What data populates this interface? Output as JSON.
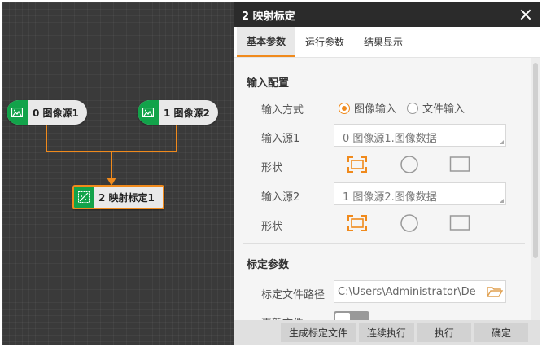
{
  "canvas": {
    "nodes": [
      {
        "label": "0 图像源1",
        "icon": "image-icon"
      },
      {
        "label": "1 图像源2",
        "icon": "image-icon"
      },
      {
        "label": "2 映射标定1",
        "icon": "calibration-icon",
        "selected": true
      }
    ],
    "connector_color": "#f08a1c",
    "node_icon_color": "#12a34a"
  },
  "panel": {
    "title": "2 映射标定",
    "tabs": [
      "基本参数",
      "运行参数",
      "结果显示"
    ],
    "active_tab": 0,
    "input_config": {
      "section_title": "输入配置",
      "input_mode_label": "输入方式",
      "input_mode_options": [
        "图像输入",
        "文件输入"
      ],
      "input_mode_selected": "图像输入",
      "source1_label": "输入源1",
      "source1_value": "0 图像源1.图像数据",
      "shape1_label": "形状",
      "source2_label": "输入源2",
      "source2_value": "1 图像源2.图像数据",
      "shape2_label": "形状",
      "shape_options": [
        "fit-frame-icon",
        "circle-icon",
        "rectangle-icon"
      ]
    },
    "calibration": {
      "section_title": "标定参数",
      "file_path_label": "标定文件路径",
      "file_path_value": "C:\\Users\\Administrator\\De",
      "update_file_label": "更新文件"
    },
    "footer": {
      "generate_label": "生成标定文件",
      "continuous_label": "连续执行",
      "execute_label": "执行",
      "confirm_label": "确定"
    },
    "accent_color": "#f08a1c"
  }
}
